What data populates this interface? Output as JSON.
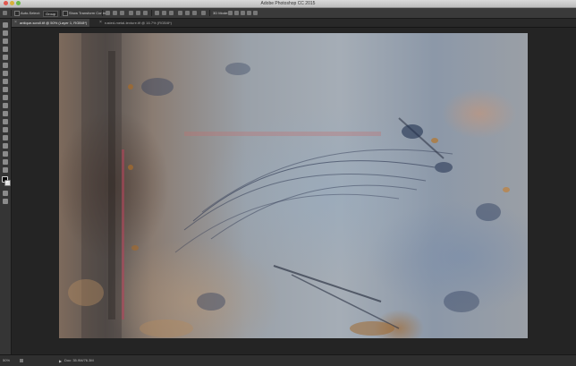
{
  "window": {
    "title": "Adobe Photoshop CC 2015"
  },
  "options_bar": {
    "auto_select_label": "Auto-Select:",
    "auto_select_value": "Group",
    "transform_label": "Show Transform Controls",
    "mode_3d_label": "3D Mode:"
  },
  "tabs": [
    {
      "label": "antique-scroll.tif @ 50% (Layer 1, RGB/8*)"
    },
    {
      "label": "rusted-metal-texture.tif @ 16.7% (RGB/8*)"
    }
  ],
  "status": {
    "zoom": "50%",
    "doc_info": "Doc: 35.9M/76.3M"
  },
  "colors": {
    "foreground": "#000000",
    "background": "#ffffff"
  }
}
